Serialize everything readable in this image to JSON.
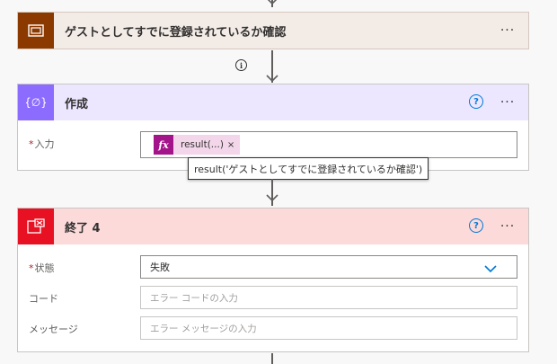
{
  "scope_card": {
    "title": "ゲストとしてすでに登録されているか確認",
    "more": "···"
  },
  "connector": {
    "info_icon": "info-icon"
  },
  "compose_card": {
    "title": "作成",
    "help": "?",
    "more": "···",
    "input": {
      "label": "入力",
      "required_mark": "*",
      "token": {
        "fx": "fx",
        "text": "result(...)",
        "remove": "×"
      }
    },
    "tooltip": "result('ゲストとしてすでに登録されているか確認')"
  },
  "terminate_card": {
    "title": "終了 4",
    "help": "?",
    "more": "···",
    "status": {
      "label": "状態",
      "required_mark": "*",
      "value": "失敗"
    },
    "code": {
      "label": "コード",
      "placeholder": "エラー コードの入力"
    },
    "message": {
      "label": "メッセージ",
      "placeholder": "エラー メッセージの入力"
    }
  },
  "colors": {
    "scope_accent": "#8c3900",
    "compose_accent": "#8c6cff",
    "terminate_accent": "#e81123",
    "token": "#a3148b",
    "link_blue": "#0078d4"
  }
}
